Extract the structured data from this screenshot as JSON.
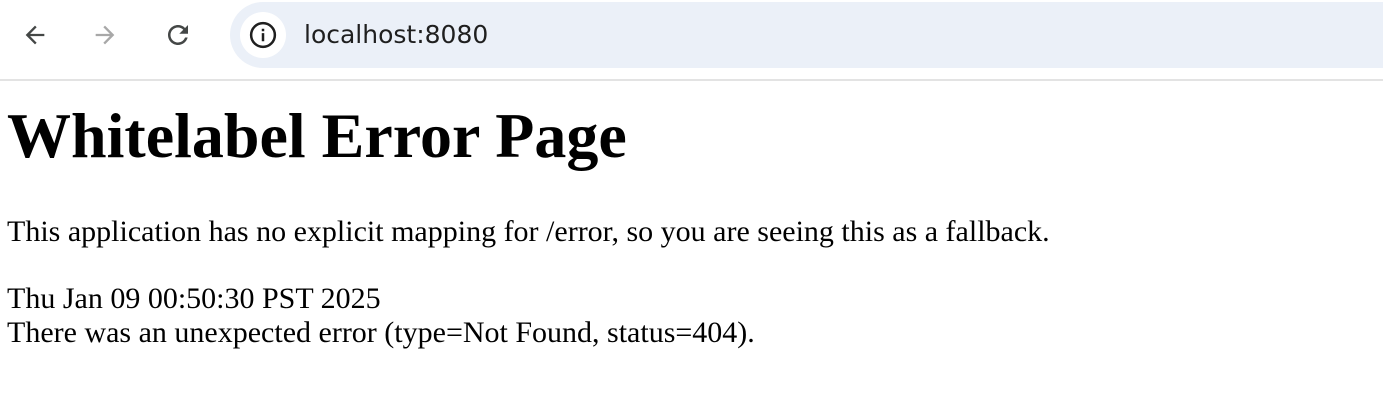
{
  "browser": {
    "url": "localhost:8080",
    "back_icon": "arrow-left",
    "forward_icon": "arrow-right",
    "reload_icon": "reload",
    "site_info_icon": "info-circle"
  },
  "page": {
    "title": "Whitelabel Error Page",
    "description": "This application has no explicit mapping for /error, so you are seeing this as a fallback.",
    "timestamp": "Thu Jan 09 00:50:30 PST 2025",
    "error_message": "There was an unexpected error (type=Not Found, status=404)."
  }
}
